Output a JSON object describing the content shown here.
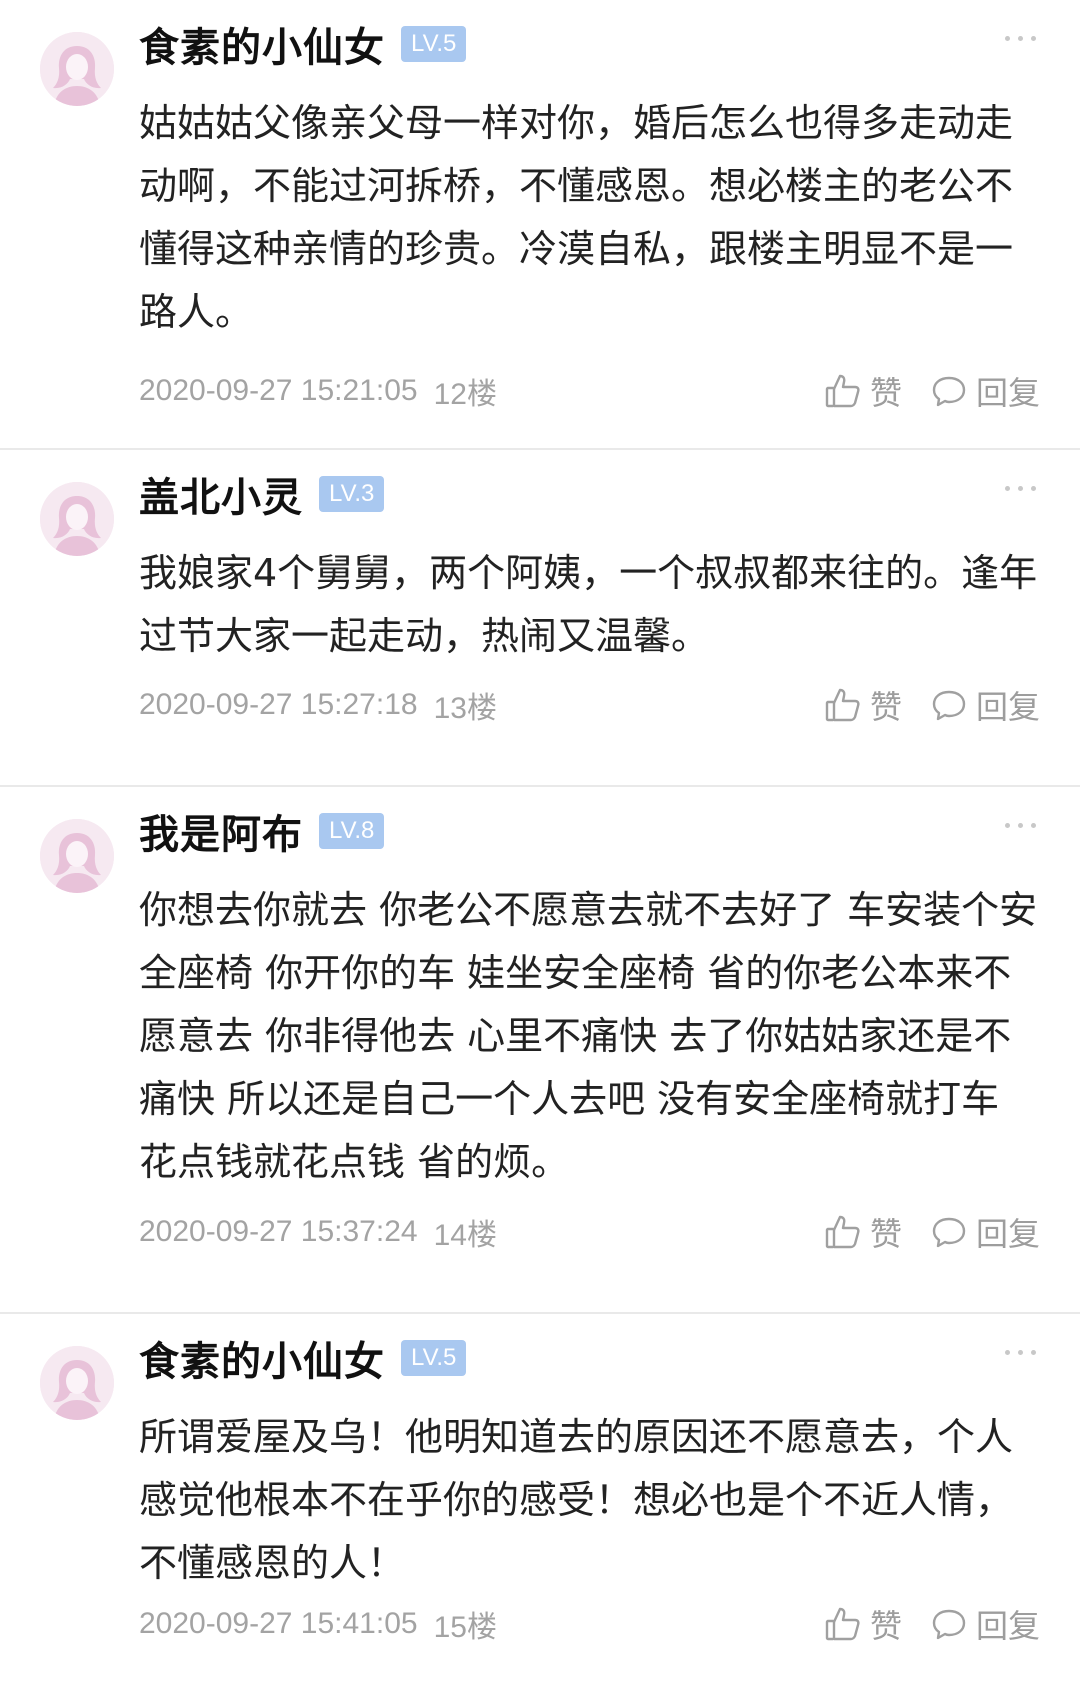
{
  "comments": [
    {
      "username": "食素的小仙女",
      "level": "LV.5",
      "text": "姑姑姑父像亲父母一样对你，婚后怎么也得多走动走动啊，不能过河拆桥，不懂感恩。想必楼主的老公不懂得这种亲情的珍贵。冷漠自私，跟楼主明显不是一路人。",
      "timestamp": "2020-09-27 15:21:05",
      "floor": "12楼",
      "like_label": "赞",
      "reply_label": "回复"
    },
    {
      "username": "盖北小灵",
      "level": "LV.3",
      "text": "我娘家4个舅舅，两个阿姨，一个叔叔都来往的。逢年过节大家一起走动，热闹又温馨。",
      "timestamp": "2020-09-27 15:27:18",
      "floor": "13楼",
      "like_label": "赞",
      "reply_label": "回复"
    },
    {
      "username": "我是阿布",
      "level": "LV.8",
      "text": "你想去你就去 你老公不愿意去就不去好了 车安装个安全座椅 你开你的车 娃坐安全座椅 省的你老公本来不愿意去 你非得他去 心里不痛快 去了你姑姑家还是不痛快 所以还是自己一个人去吧 没有安全座椅就打车 花点钱就花点钱 省的烦。",
      "timestamp": "2020-09-27 15:37:24",
      "floor": "14楼",
      "like_label": "赞",
      "reply_label": "回复"
    },
    {
      "username": "食素的小仙女",
      "level": "LV.5",
      "text": "所谓爱屋及乌！他明知道去的原因还不愿意去，个人感觉他根本不在乎你的感受！想必也是个不近人情，不懂感恩的人！",
      "timestamp": "2020-09-27 15:41:05",
      "floor": "15楼",
      "like_label": "赞",
      "reply_label": "回复"
    }
  ],
  "colors": {
    "badge_bg": "#a9c8f0",
    "meta_text": "#a3a3a3",
    "avatar_bg": "#f6e9f1"
  },
  "icons": {
    "avatar": "default-female-avatar-icon",
    "more": "more-dots-icon",
    "like": "thumbs-up-icon",
    "reply": "comment-bubble-icon"
  }
}
